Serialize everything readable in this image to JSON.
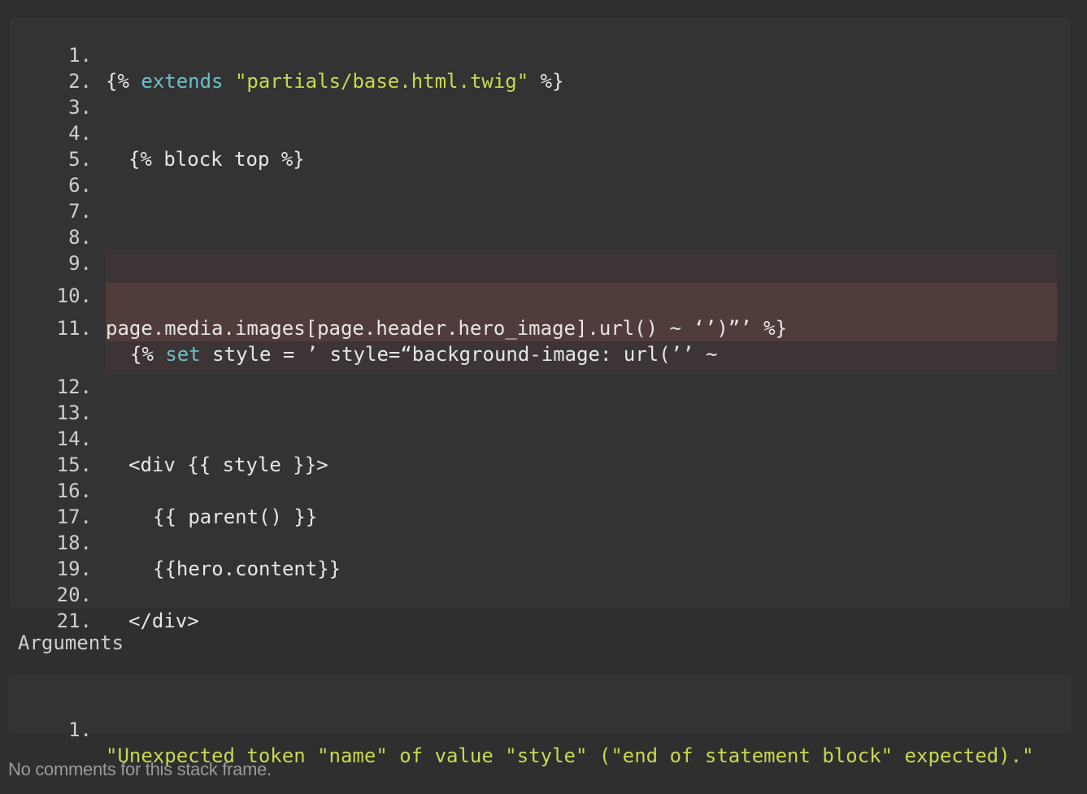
{
  "code": {
    "lines": [
      {
        "n": "1.",
        "tokens": [
          {
            "t": "{% ",
            "c": "plain"
          },
          {
            "t": "extends",
            "c": "kw"
          },
          {
            "t": " ",
            "c": "plain"
          },
          {
            "t": "\"partials/base.html.twig\"",
            "c": "str"
          },
          {
            "t": " %}",
            "c": "plain"
          }
        ]
      },
      {
        "n": "2.",
        "tokens": []
      },
      {
        "n": "3.",
        "tokens": []
      },
      {
        "n": "4.",
        "tokens": [
          {
            "t": "{% block top %}",
            "c": "plain"
          }
        ]
      },
      {
        "n": "5.",
        "tokens": []
      },
      {
        "n": "6.",
        "tokens": []
      },
      {
        "n": "7.",
        "tokens": []
      },
      {
        "n": "8.",
        "tokens": []
      },
      {
        "n": "9.",
        "tokens": []
      },
      {
        "n": "10.",
        "tokens": []
      },
      {
        "n": "11.",
        "tokens": [
          {
            "t": "{% ",
            "c": "plain"
          },
          {
            "t": "set",
            "c": "kw"
          },
          {
            "t": " style = ’ style=“background-image: url(’’ ~",
            "c": "plain"
          }
        ],
        "cont": "page.media.images[page.header.hero_image].url() ~ ‘’)”’ %}"
      },
      {
        "n": "12.",
        "tokens": []
      },
      {
        "n": "13.",
        "tokens": []
      },
      {
        "n": "14.",
        "tokens": [
          {
            "t": "<div {{ style }}>",
            "c": "plain"
          }
        ]
      },
      {
        "n": "15.",
        "tokens": []
      },
      {
        "n": "16.",
        "tokens": [
          {
            "t": "{{ parent() }}",
            "c": "plain"
          }
        ]
      },
      {
        "n": "17.",
        "tokens": []
      },
      {
        "n": "18.",
        "tokens": [
          {
            "t": "{{hero.content}}",
            "c": "plain"
          }
        ]
      },
      {
        "n": "19.",
        "tokens": []
      },
      {
        "n": "20.",
        "tokens": [
          {
            "t": "</div>",
            "c": "plain"
          }
        ]
      },
      {
        "n": "21.",
        "tokens": []
      }
    ]
  },
  "arguments": {
    "heading": "Arguments",
    "items": [
      {
        "n": "1.",
        "value": "\"Unexpected token \"name\" of value \"style\" (\"end of statement block\" expected).\""
      }
    ]
  },
  "footer": {
    "text": "No comments for this stack frame."
  },
  "colors": {
    "background": "#2f2f2f",
    "panel": "#333333",
    "keyword": "#6ac0c7",
    "string": "#c9d84f",
    "highlight": "#513c3c"
  }
}
